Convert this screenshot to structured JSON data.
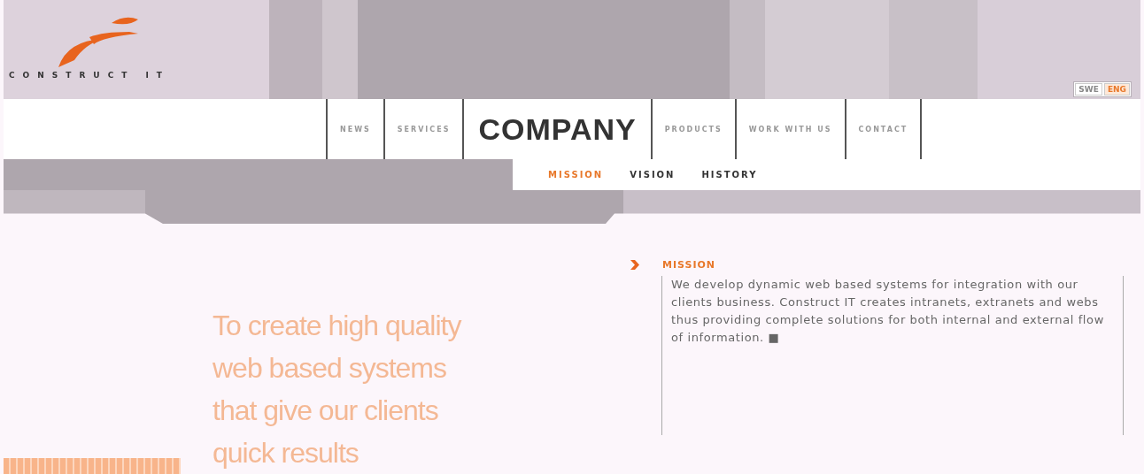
{
  "logo": {
    "text": "CONSTRUCT IT"
  },
  "languages": [
    {
      "label": "SWE",
      "selected": false
    },
    {
      "label": "ENG",
      "selected": true
    }
  ],
  "nav": [
    {
      "label": "NEWS",
      "selected": false
    },
    {
      "label": "SERVICES",
      "selected": false
    },
    {
      "label": "COMPANY",
      "selected": true
    },
    {
      "label": "PRODUCTS",
      "selected": false
    },
    {
      "label": "WORK WITH US",
      "selected": false
    },
    {
      "label": "CONTACT",
      "selected": false
    }
  ],
  "subnav": [
    {
      "label": "MISSION",
      "selected": true
    },
    {
      "label": "VISION",
      "selected": false
    },
    {
      "label": "HISTORY",
      "selected": false
    }
  ],
  "tagline": [
    "To create high quality",
    "web based systems",
    "that give our clients",
    "quick results"
  ],
  "section": {
    "heading": "MISSION",
    "text": "We develop dynamic web based systems for integration with our clients business. Construct IT creates intranets, extranets and webs thus providing complete solutions for both internal and external flow of information. ■"
  }
}
